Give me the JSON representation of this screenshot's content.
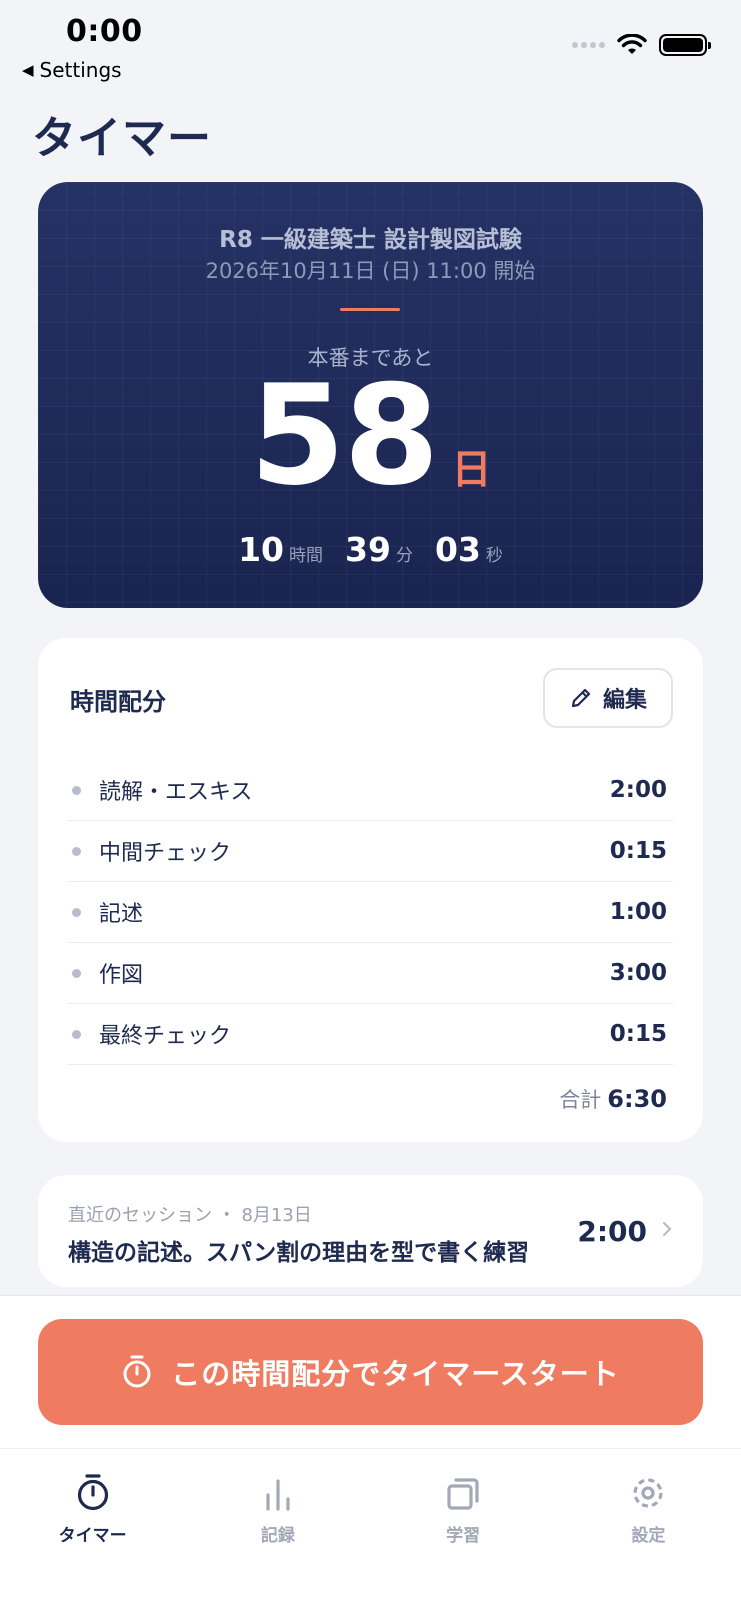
{
  "status_bar": {
    "time": "0:00",
    "back_label": "Settings"
  },
  "page_title": "タイマー",
  "countdown": {
    "exam_name": "R8 一級建築士 設計製図試験",
    "exam_datetime": "2026年10月11日 (日) 11:00 開始",
    "until_label": "本番まであと",
    "days": "58",
    "days_unit": "日",
    "hours": "10",
    "hours_unit": "時間",
    "minutes": "39",
    "minutes_unit": "分",
    "seconds": "03",
    "seconds_unit": "秒"
  },
  "allocation": {
    "title": "時間配分",
    "edit_label": "編集",
    "items": [
      {
        "name": "読解・エスキス",
        "time": "2:00"
      },
      {
        "name": "中間チェック",
        "time": "0:15"
      },
      {
        "name": "記述",
        "time": "1:00"
      },
      {
        "name": "作図",
        "time": "3:00"
      },
      {
        "name": "最終チェック",
        "time": "0:15"
      }
    ],
    "total_label": "合計",
    "total_value": "6:30"
  },
  "recent_session": {
    "meta": "直近のセッション ・ 8月13日",
    "title": "構造の記述。スパン割の理由を型で書く練習",
    "duration": "2:00"
  },
  "start_button_label": "この時間配分でタイマースタート",
  "tabs": [
    {
      "label": "タイマー",
      "icon": "stopwatch-icon",
      "active": true
    },
    {
      "label": "記録",
      "icon": "bar-chart-icon",
      "active": false
    },
    {
      "label": "学習",
      "icon": "cards-icon",
      "active": false
    },
    {
      "label": "設定",
      "icon": "gear-icon",
      "active": false
    }
  ],
  "colors": {
    "accent": "#ef7b61",
    "navy": "#1e2a4f",
    "hero_bg": "#1f2b58",
    "page_bg": "#f2f4f8",
    "tab_inactive": "#a3a8b6"
  }
}
